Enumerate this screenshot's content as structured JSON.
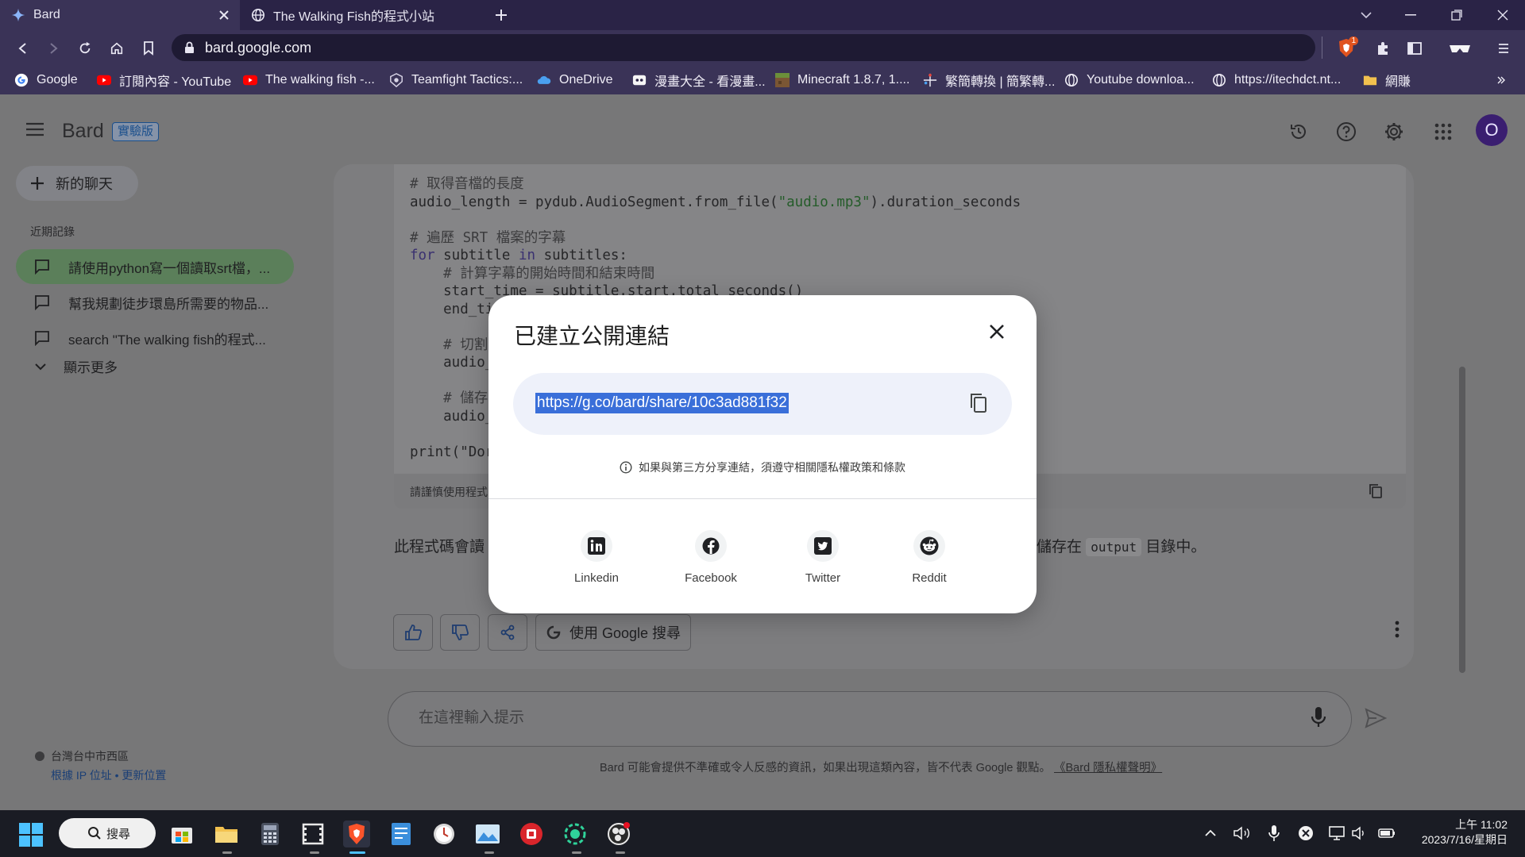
{
  "browser": {
    "tabs": [
      {
        "title": "Bard",
        "active": true
      },
      {
        "title": "The Walking Fish的程式小站",
        "active": false
      }
    ],
    "url": "bard.google.com",
    "bookmarks": [
      {
        "label": "Google",
        "icon": "google-icon"
      },
      {
        "label": "訂閱內容 - YouTube",
        "icon": "youtube-icon"
      },
      {
        "label": "The walking fish -...",
        "icon": "youtube-icon"
      },
      {
        "label": "Teamfight Tactics:...",
        "icon": "tft-icon"
      },
      {
        "label": "OneDrive",
        "icon": "onedrive-icon"
      },
      {
        "label": "漫畫大全 - 看漫畫...",
        "icon": "manga-icon"
      },
      {
        "label": "Minecraft 1.8.7, 1....",
        "icon": "minecraft-icon"
      },
      {
        "label": "繁簡轉換 | 簡繁轉...",
        "icon": "convert-icon"
      },
      {
        "label": "Youtube downloa...",
        "icon": "globe-icon"
      },
      {
        "label": "https://itechdct.nt...",
        "icon": "globe-icon"
      },
      {
        "label": "網賺",
        "icon": "folder-icon"
      }
    ],
    "brave_badge": "1"
  },
  "app": {
    "title": "Bard",
    "badge": "實驗版",
    "avatar_letter": "O",
    "new_chat_label": "新的聊天",
    "recent_heading": "近期記錄",
    "recent_items": [
      "請使用python寫一個讀取srt檔，...",
      "幫我規劃徒步環島所需要的物品...",
      "search \"The walking fish的程式..."
    ],
    "show_more_label": "顯示更多",
    "location": "台灣台中市西區",
    "location_links": "根據 IP 位址 • 更新位置"
  },
  "chat": {
    "code_lines": [
      {
        "type": "cmt",
        "text": "# 取得音檔的長度"
      },
      {
        "type": "code",
        "parts": [
          [
            "",
            "audio_length = pydub.AudioSegment.from_file("
          ],
          [
            "str",
            "\"audio.mp3\""
          ],
          [
            "",
            ").duration_seconds"
          ]
        ]
      },
      {
        "type": "blank"
      },
      {
        "type": "cmt",
        "text": "# 遍歷 SRT 檔案的字幕"
      },
      {
        "type": "code",
        "parts": [
          [
            "kw",
            "for"
          ],
          [
            "",
            " subtitle "
          ],
          [
            "kw",
            "in"
          ],
          [
            "",
            " subtitles:"
          ]
        ]
      },
      {
        "type": "cmt",
        "text": "    # 計算字幕的開始時間和結束時間"
      },
      {
        "type": "code",
        "parts": [
          [
            "",
            "    start_time = subtitle.start.total_seconds()"
          ]
        ]
      },
      {
        "type": "code",
        "parts": [
          [
            "",
            "    end_ti"
          ]
        ]
      },
      {
        "type": "blank"
      },
      {
        "type": "cmt",
        "text": "    # 切割"
      },
      {
        "type": "code",
        "parts": [
          [
            "",
            "    audio_                                                   end_time)"
          ]
        ]
      },
      {
        "type": "blank"
      },
      {
        "type": "cmt",
        "text": "    # 儲存"
      },
      {
        "type": "code",
        "parts": [
          [
            "",
            "    audio_"
          ]
        ]
      },
      {
        "type": "blank"
      },
      {
        "type": "code",
        "parts": [
          [
            "",
            "print(\"Dor"
          ]
        ]
      }
    ],
    "code_disclaimer": "請謹慎使用程式",
    "response_start": "此程式碼會讀",
    "response_end_before": "儲存在",
    "response_code": "output",
    "response_end_after": "目錄中。",
    "google_search_label": "使用 Google 搜尋",
    "prompt_placeholder": "在這裡輸入提示",
    "footer_note": "Bard 可能會提供不準確或令人反感的資訊，如果出現這類內容，皆不代表 Google 觀點。",
    "footer_link": "《Bard 隱私權聲明》"
  },
  "dialog": {
    "title": "已建立公開連結",
    "link": "https://g.co/bard/share/10c3ad881f32",
    "note": "如果與第三方分享連結，須遵守相關隱私權政策和條款",
    "share_options": [
      {
        "label": "Linkedin",
        "icon": "linkedin-icon"
      },
      {
        "label": "Facebook",
        "icon": "facebook-icon"
      },
      {
        "label": "Twitter",
        "icon": "twitter-icon"
      },
      {
        "label": "Reddit",
        "icon": "reddit-icon"
      }
    ]
  },
  "taskbar": {
    "search_label": "搜尋",
    "time": "上午 11:02",
    "date": "2023/7/16/星期日"
  },
  "colors": {
    "accent": "#3a6fd9",
    "chrome": "#3a3357",
    "overlay": "#777778"
  }
}
